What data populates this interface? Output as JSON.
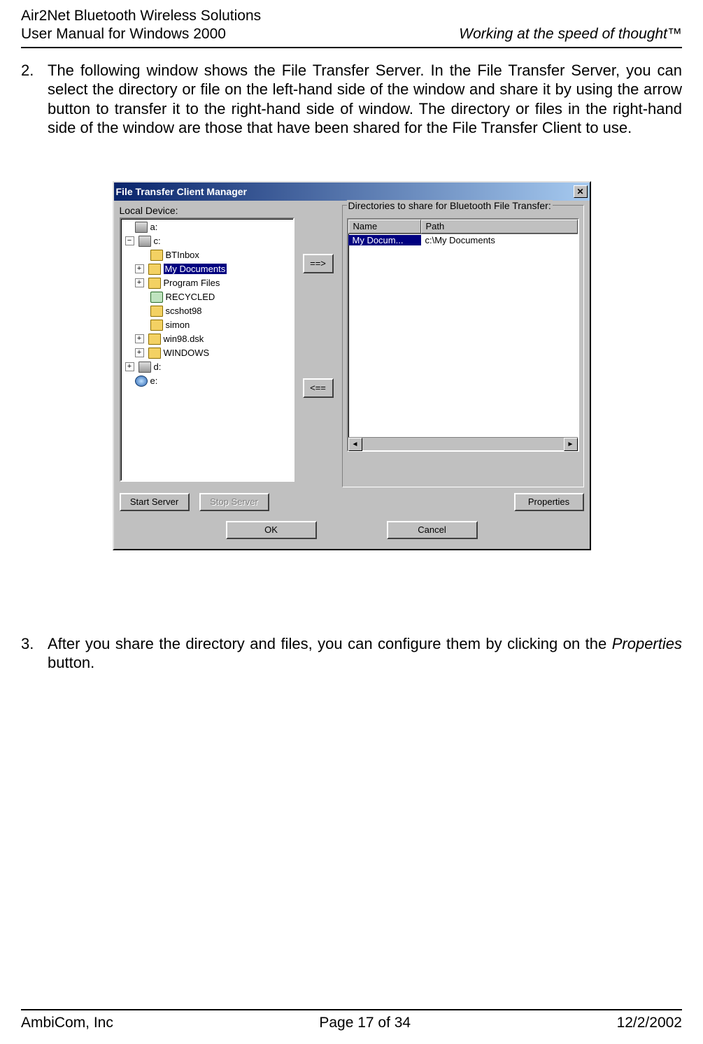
{
  "header": {
    "left_line1": "Air2Net Bluetooth Wireless Solutions",
    "left_line2": "User Manual for Windows 2000",
    "right": "Working at the speed of thought™"
  },
  "step2_num": "2.",
  "step2_text": "The following window shows the File Transfer Server. In the File Transfer Server, you can select the directory or file on the left-hand side of the window and share it by using the arrow button to transfer it to the right-hand side of window. The directory or files in the right-hand side of the window are those that have been shared for the File Transfer Client to use.",
  "win": {
    "title": "File Transfer Client  Manager",
    "close_glyph": "✕",
    "left_label": "Local Device:",
    "right_label": "Directories to share for Bluetooth File Transfer:",
    "mid_right_btn": "==>",
    "mid_left_btn": "<==",
    "tree": {
      "a": "a:",
      "c": "c:",
      "btinbox": "BTInbox",
      "mydocs": "My Documents",
      "progfiles": "Program Files",
      "recycled": "RECYCLED",
      "scshot": "scshot98",
      "simon": "simon",
      "win98": "win98.dsk",
      "windows": "WINDOWS",
      "d": "d:",
      "e": "e:",
      "plus": "+",
      "minus": "−"
    },
    "headers": {
      "name": "Name",
      "path": "Path"
    },
    "row": {
      "name": "My Docum...",
      "path": "c:\\My Documents"
    },
    "scroll": {
      "left": "◄",
      "right": "►"
    },
    "buttons": {
      "start": "Start Server",
      "stop": "Stop Server",
      "props": "Properties",
      "ok": "OK",
      "cancel": "Cancel"
    }
  },
  "step3_num": "3.",
  "step3_pre": "After you share the directory and files, you can configure them by clicking on the ",
  "step3_italic": "Properties",
  "step3_post": " button.",
  "footer": {
    "left": "AmbiCom, Inc",
    "center": "Page 17 of 34",
    "right": "12/2/2002"
  }
}
